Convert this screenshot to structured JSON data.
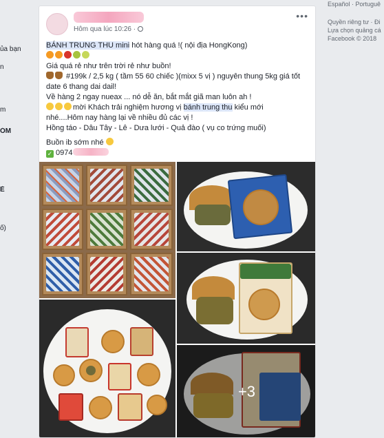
{
  "left_sidebar": {
    "items": [
      "ủa bạn",
      "n",
      "m",
      "ÓM",
      "Ẻ",
      "ố)"
    ]
  },
  "right_sidebar": {
    "lang_top": "Español · Portuguê",
    "privacy": "Quyền riêng tư · Đi",
    "ad_choices": "Lựa chọn quảng cá",
    "copyright": "Facebook © 2018"
  },
  "post": {
    "timestamp": "Hôm qua lúc 10:26 ·",
    "more_label": "•••",
    "lines": {
      "l1_highlight": "BÁNH TRUNG THU mini",
      "l1_rest": " hót hàng quá !( nội địa HongKong)",
      "l3": "Giá quá rẻ như trên trời rẻ như buồn!",
      "l4": " #199k / 2,5 kg ( tầm 55 60 chiếc )(mixx 5 vị ) nguyên thung 5kg giá tốt",
      "l5": "date 6 thang dai dail!",
      "l6": "Về hàng 2 ngay nueax ... nó dễ ăn, bắt mắt giã man luôn ah !",
      "l7_pre": "mời Khách trải nghiệm hương vị ",
      "l7_highlight": "bánh trung thu",
      "l7_post": " kiểu mới",
      "l8": "nhé....Hôm nay hàng lại về nhiều đủ các vị !",
      "l9": "Hồng táo - Dâu Tây - Lê - Dưa lưới - Quả đào ( vụ co trứng muối)",
      "l10": "Buồn ib sớm nhé ",
      "l11": " 0974"
    },
    "more_photos": "+3"
  },
  "colors": {
    "highlight": "#dce6f8",
    "blur_pink": "#f4a6be"
  }
}
